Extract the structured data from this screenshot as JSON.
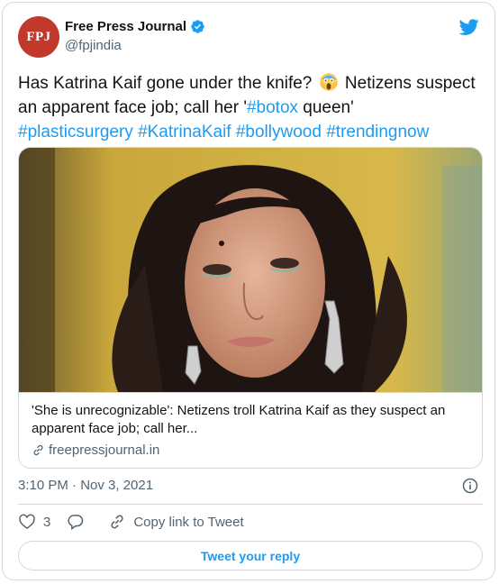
{
  "author": {
    "avatar_text": "FPJ",
    "name": "Free Press Journal",
    "handle": "@fpjindia"
  },
  "tweet": {
    "text_1": "Has Katrina Kaif gone under the knife? ",
    "text_2": " Netizens suspect an apparent face job; call her '",
    "hashtag_botox": "#botox",
    "text_3": " queen'",
    "hashtags": [
      "#plasticsurgery",
      "#KatrinaKaif",
      "#bollywood",
      "#trendingnow"
    ],
    "emoji_icon": "screaming-face-emoji"
  },
  "link_card": {
    "title": "'She is unrecognizable': Netizens troll Katrina Kaif as they suspect an apparent face job; call her...",
    "domain": "freepressjournal.in"
  },
  "meta": {
    "timestamp": "3:10 PM · Nov 3, 2021"
  },
  "actions": {
    "like_count": "3",
    "copy_link_label": "Copy link to Tweet",
    "reply_button_label": "Tweet your reply"
  },
  "colors": {
    "accent": "#1d9bf0",
    "avatar_bg": "#c0392b",
    "secondary_text": "#536471",
    "border": "#cfd9de"
  }
}
